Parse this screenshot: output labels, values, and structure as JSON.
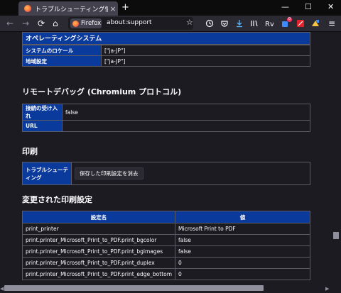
{
  "tab": {
    "title": "トラブルシューティング情報",
    "close": "×",
    "new": "+"
  },
  "window": {
    "minimize": "—",
    "maximize": "☐",
    "close": "✕"
  },
  "nav": {
    "back": "←",
    "forward": "→",
    "reload": "⟳",
    "home": "⌂",
    "identity": "Firefox",
    "url": "about:support",
    "star": "☆",
    "menu": "≡",
    "badge": "0"
  },
  "operating_system": {
    "heading": "オペレーティングシステム",
    "rows": [
      {
        "label": "システムのロケール",
        "value": "[\"ja-JP\"]"
      },
      {
        "label": "地域設定",
        "value": "[\"ja-JP\"]"
      }
    ]
  },
  "remote_debug": {
    "heading": "リモートデバッグ (Chromium プロトコル)",
    "rows": [
      {
        "label": "接続の受け入れ",
        "value": "false"
      },
      {
        "label": "URL",
        "value": ""
      }
    ]
  },
  "printing": {
    "heading": "印刷",
    "row_label": "トラブルシューティング",
    "button": "保存した印刷設定を消去"
  },
  "modified_print": {
    "heading": "変更された印刷設定",
    "col_name": "設定名",
    "col_value": "値",
    "rows": [
      {
        "name": "print_printer",
        "value": "Microsoft Print to PDF"
      },
      {
        "name": "print.printer_Microsoft_Print_to_PDF.print_bgcolor",
        "value": "false"
      },
      {
        "name": "print.printer_Microsoft_Print_to_PDF.print_bgimages",
        "value": "false"
      },
      {
        "name": "print.printer_Microsoft_Print_to_PDF.print_duplex",
        "value": "0"
      },
      {
        "name": "print.printer_Microsoft_Print_to_PDF.print_edge_bottom",
        "value": "0"
      }
    ]
  }
}
